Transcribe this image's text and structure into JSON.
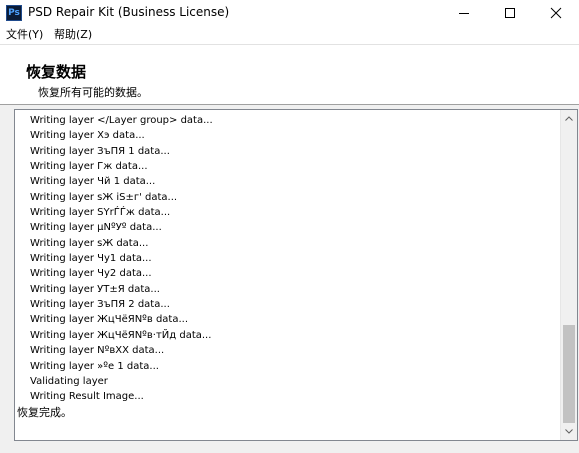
{
  "window": {
    "title": "PSD Repair Kit (Business License)",
    "icon_text": "Ps"
  },
  "menu": {
    "file": "文件(Y)",
    "help": "帮助(Z)"
  },
  "header": {
    "title": "恢复数据",
    "subtitle": "恢复所有可能的数据。"
  },
  "log": {
    "lines": [
      "Writing layer </Layer group> data...",
      "Writing layer Хэ data...",
      "Writing layer ЗъПЯ 1 data...",
      "Writing layer Гж data...",
      "Writing layer Чй 1 data...",
      "Writing layer sЖ iS±г' data...",
      "Writing layer SYrЃЃж data...",
      "Writing layer µNºУº data...",
      "Writing layer sЖ data...",
      "Writing layer Чу1 data...",
      "Writing layer Чу2 data...",
      "Writing layer УТ±Я data...",
      "Writing layer ЗъПЯ 2 data...",
      "Writing layer ЖцЧёЯNºв data...",
      "Writing layer ЖцЧёЯNºв·тЙд data...",
      "Writing layer NºвXX data...",
      "Writing layer »ºе 1 data...",
      "Validating layer",
      "Writing Result Image..."
    ],
    "final_line": "恢复完成。"
  },
  "colors": {
    "background": "#f0f0f0",
    "log_border": "#828790",
    "scroll_thumb": "#c2c2c2"
  }
}
